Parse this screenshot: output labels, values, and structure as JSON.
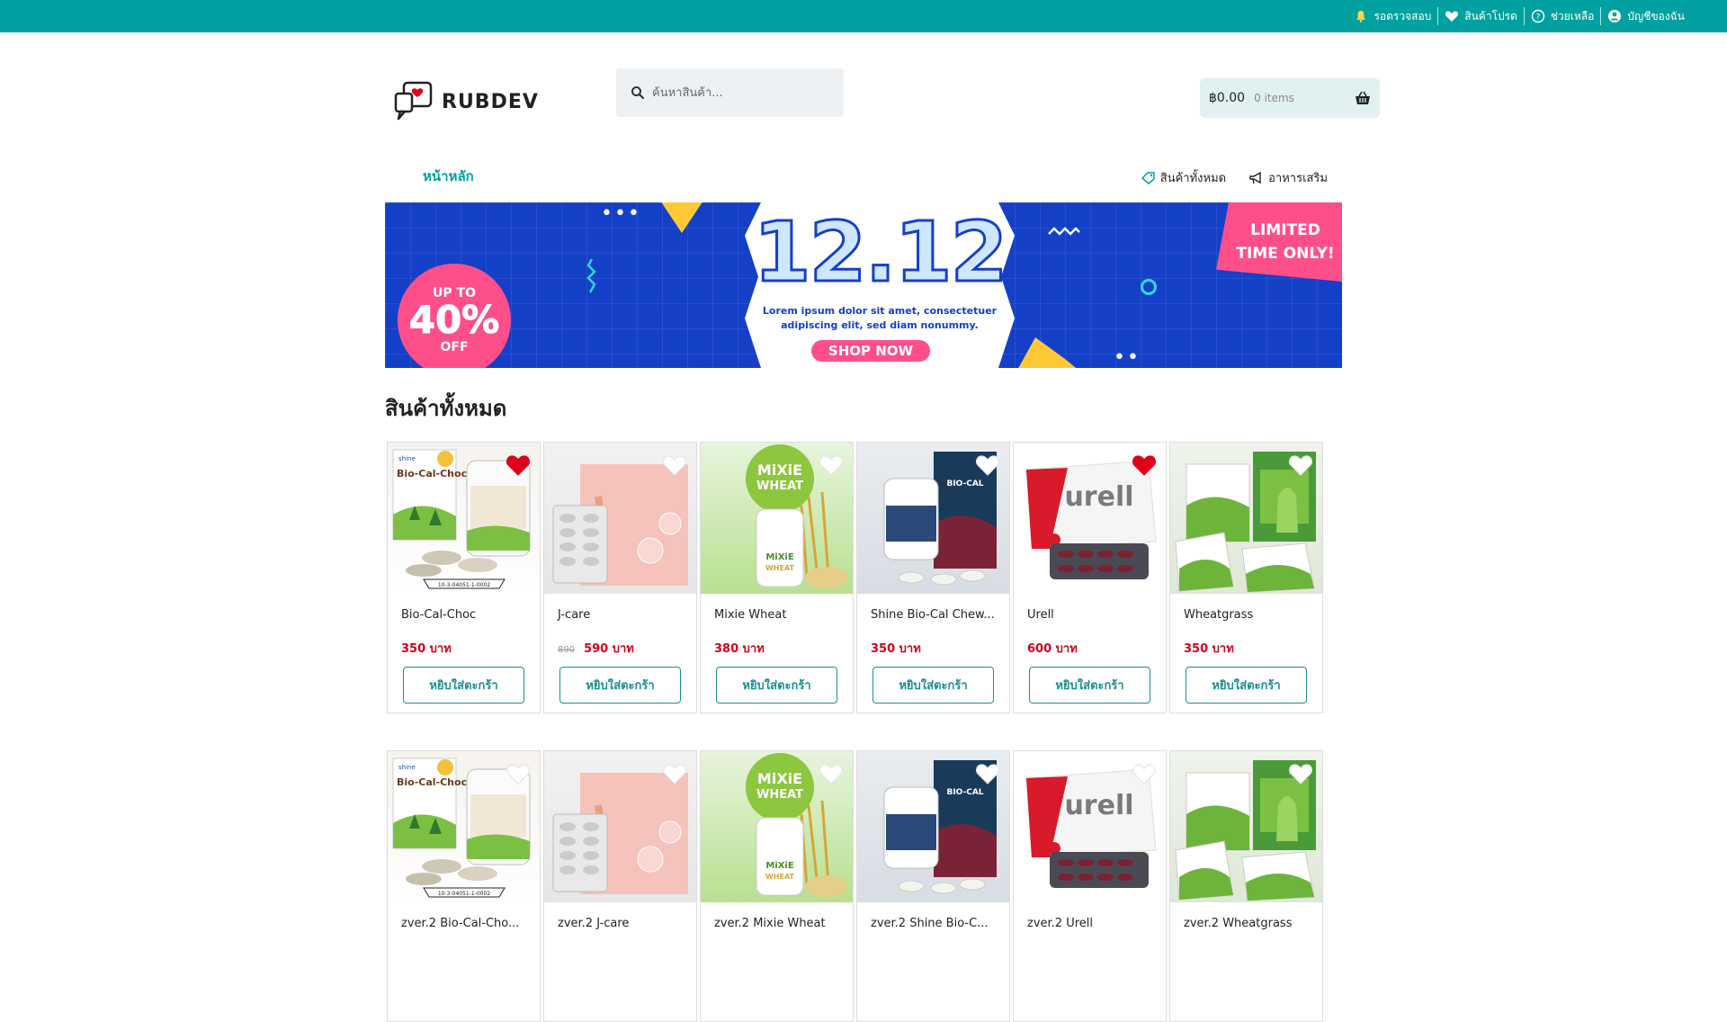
{
  "topbar": {
    "links": [
      {
        "label": "รอตรวจสอบ",
        "icon": "bell-icon"
      },
      {
        "label": "สินค้าโปรด",
        "icon": "heart-icon"
      },
      {
        "label": "ช่วยเหลือ",
        "icon": "help-icon"
      },
      {
        "label": "บัญชีของฉัน",
        "icon": "user-icon"
      }
    ],
    "color": "#00a1a0"
  },
  "brand": {
    "name": "RUBDEV"
  },
  "search": {
    "placeholder": "ค้นหาสินค้า..."
  },
  "cart": {
    "total": "฿0.00",
    "items": "0 items"
  },
  "nav": {
    "home": "หน้าหลัก",
    "items": [
      {
        "label": "สินค้าทั้งหมด",
        "icon": "tag-icon"
      },
      {
        "label": "อาหารเสริม",
        "icon": "megaphone-icon"
      }
    ]
  },
  "banner": {
    "upto": "UP TO",
    "percent": "40%",
    "off": "OFF",
    "title": "12.12",
    "subtitle": "Lorem ipsum dolor sit amet, consectetuer adipiscing elit, sed diam nonummy.",
    "shop_now": "SHOP NOW",
    "limited_1": "LIMITED",
    "limited_2": "TIME ONLY!"
  },
  "section": {
    "title": "สินค้าทั้งหมด"
  },
  "products_row1": [
    {
      "name": "Bio-Cal-Choc",
      "price": "350 บาท",
      "old_price": "",
      "button": "หยิบใส่ตะกร้า",
      "favorite": true,
      "img": "biocal"
    },
    {
      "name": "J-care",
      "price": "590 บาท",
      "old_price": "890",
      "button": "หยิบใส่ตะกร้า",
      "favorite": false,
      "img": "jcare"
    },
    {
      "name": "Mixie Wheat",
      "price": "380 บาท",
      "old_price": "",
      "button": "หยิบใส่ตะกร้า",
      "favorite": false,
      "img": "mixie"
    },
    {
      "name": "Shine Bio-Cal Chew...",
      "price": "350 บาท",
      "old_price": "",
      "button": "หยิบใส่ตะกร้า",
      "favorite": false,
      "img": "shine"
    },
    {
      "name": "Urell",
      "price": "600 บาท",
      "old_price": "",
      "button": "หยิบใส่ตะกร้า",
      "favorite": true,
      "img": "urell"
    },
    {
      "name": "Wheatgrass",
      "price": "350 บาท",
      "old_price": "",
      "button": "หยิบใส่ตะกร้า",
      "favorite": false,
      "img": "wheat"
    }
  ],
  "products_row2": [
    {
      "name": "zver.2 Bio-Cal-Cho...",
      "img": "biocal",
      "favorite": false
    },
    {
      "name": "zver.2 J-care",
      "img": "jcare",
      "favorite": false
    },
    {
      "name": "zver.2 Mixie Wheat",
      "img": "mixie",
      "favorite": false
    },
    {
      "name": "zver.2 Shine Bio-C...",
      "img": "shine",
      "favorite": false
    },
    {
      "name": "zver.2 Urell",
      "img": "urell",
      "favorite": false
    },
    {
      "name": "zver.2 Wheatgrass",
      "img": "wheat",
      "favorite": false
    }
  ],
  "image_text": {
    "biocal_title": "Bio-Cal-Choc",
    "biocal_brand": "shine",
    "biocal_code": "10-3-04051-1-0002",
    "mixie_1": "MiXiE",
    "mixie_2": "WHEAT",
    "urell": "urell",
    "shine": "BIO-CAL"
  },
  "colors": {
    "accent": "#00a1a0",
    "price": "#d0021b",
    "heart_active": "#e0001a",
    "button": "#1a8f93"
  }
}
